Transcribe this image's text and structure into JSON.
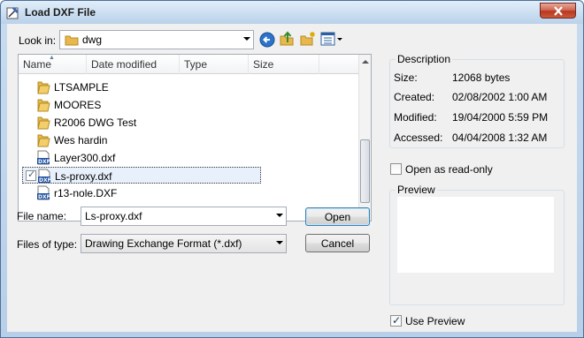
{
  "window": {
    "title": "Load DXF File"
  },
  "toolbar": {
    "look_in_label": "Look in:",
    "look_in_value": "dwg",
    "icons": [
      "back-icon",
      "up-folder-icon",
      "new-folder-icon",
      "view-menu-icon"
    ]
  },
  "list": {
    "columns": [
      "Name",
      "Date modified",
      "Type",
      "Size"
    ],
    "items": [
      {
        "name": "LTSAMPLE",
        "type": "folder"
      },
      {
        "name": "MOORES",
        "type": "folder"
      },
      {
        "name": "R2006 DWG Test",
        "type": "folder"
      },
      {
        "name": "Wes hardin",
        "type": "folder"
      },
      {
        "name": "Layer300.dxf",
        "type": "dxf"
      },
      {
        "name": "Ls-proxy.dxf",
        "type": "dxf",
        "selected": true
      },
      {
        "name": "r13-nole.DXF",
        "type": "dxf"
      }
    ]
  },
  "file_name": {
    "label": "File name:",
    "value": "Ls-proxy.dxf"
  },
  "file_type": {
    "label": "Files of type:",
    "value": "Drawing Exchange Format (*.dxf)"
  },
  "buttons": {
    "open": "Open",
    "cancel": "Cancel"
  },
  "description": {
    "title": "Description",
    "size_label": "Size:",
    "size_value": "12068 bytes",
    "created_label": "Created:",
    "created_value": "02/08/2002 1:00 AM",
    "modified_label": "Modified:",
    "modified_value": "19/04/2000 5:59 PM",
    "accessed_label": "Accessed:",
    "accessed_value": "04/04/2008 1:32 AM"
  },
  "open_read_only": {
    "label": "Open as read-only",
    "checked": false
  },
  "preview": {
    "title": "Preview"
  },
  "use_preview": {
    "label": "Use Preview",
    "checked": true
  },
  "colors": {
    "dxf_icon": "#1c4fa0",
    "folder": "#e8b94a",
    "default_button_border": "#3c7fb1"
  }
}
